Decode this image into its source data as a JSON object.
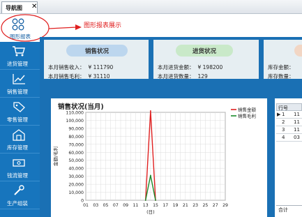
{
  "tab": {
    "label": "导航图",
    "close": "✕"
  },
  "nav_top": {
    "label": "图形报表",
    "icon": "grid-icon"
  },
  "nav": [
    {
      "label": "进货管理",
      "icon": "cart-icon"
    },
    {
      "label": "销售管理",
      "icon": "trend-icon"
    },
    {
      "label": "零售管理",
      "icon": "tag-icon"
    },
    {
      "label": "库存管理",
      "icon": "warehouse-icon"
    },
    {
      "label": "钱流管理",
      "icon": "money-icon"
    },
    {
      "label": "生产组装",
      "icon": "wrench-icon"
    }
  ],
  "annotation": {
    "text": "图形报表展示",
    "color": "#e02020"
  },
  "cards": {
    "sales": {
      "title": "销售状况",
      "line1_label": "本月销售收入：",
      "line1_value": "¥ 111790",
      "line2_label": "本月销售毛利：",
      "line2_value": "¥ 31110"
    },
    "purchase": {
      "title": "进货状况",
      "line1_label": "本月进货金额：",
      "line1_value": "¥ 198200",
      "line2_label": "本月进货数量：",
      "line2_value": "129"
    },
    "stock": {
      "line1_label": "库存金额：",
      "line2_label": "库存数量："
    }
  },
  "chart_data": {
    "type": "line",
    "title": "销售状况(当月)",
    "xlabel": "(日)",
    "ylabel": "金额/毛利",
    "x_ticks": [
      "01",
      "03",
      "05",
      "07",
      "09",
      "11",
      "13",
      "15",
      "17",
      "19",
      "21",
      "23",
      "25",
      "27",
      "29"
    ],
    "y_ticks": [
      "0",
      "10,000",
      "20,000",
      "30,000",
      "40,000",
      "50,000",
      "60,000",
      "70,000",
      "80,000",
      "90,000",
      "100,000",
      "110,000"
    ],
    "ylim": [
      0,
      110000
    ],
    "xlim": [
      1,
      29
    ],
    "grid": true,
    "legend_position": "right",
    "x": [
      13,
      14,
      15
    ],
    "series": [
      {
        "name": "销售金额",
        "color": "#e02020",
        "values": [
          0,
          111790,
          0
        ]
      },
      {
        "name": "销售毛利",
        "color": "#1a8a2a",
        "values": [
          0,
          31110,
          0
        ]
      }
    ]
  },
  "table": {
    "header": "行号",
    "rows": [
      {
        "index": "1",
        "value": "11",
        "marker": "▶"
      },
      {
        "index": "2",
        "value": "11",
        "marker": ""
      },
      {
        "index": "3",
        "value": "11",
        "marker": ""
      },
      {
        "index": "4",
        "value": "03",
        "marker": ""
      }
    ],
    "footer": "合计"
  }
}
